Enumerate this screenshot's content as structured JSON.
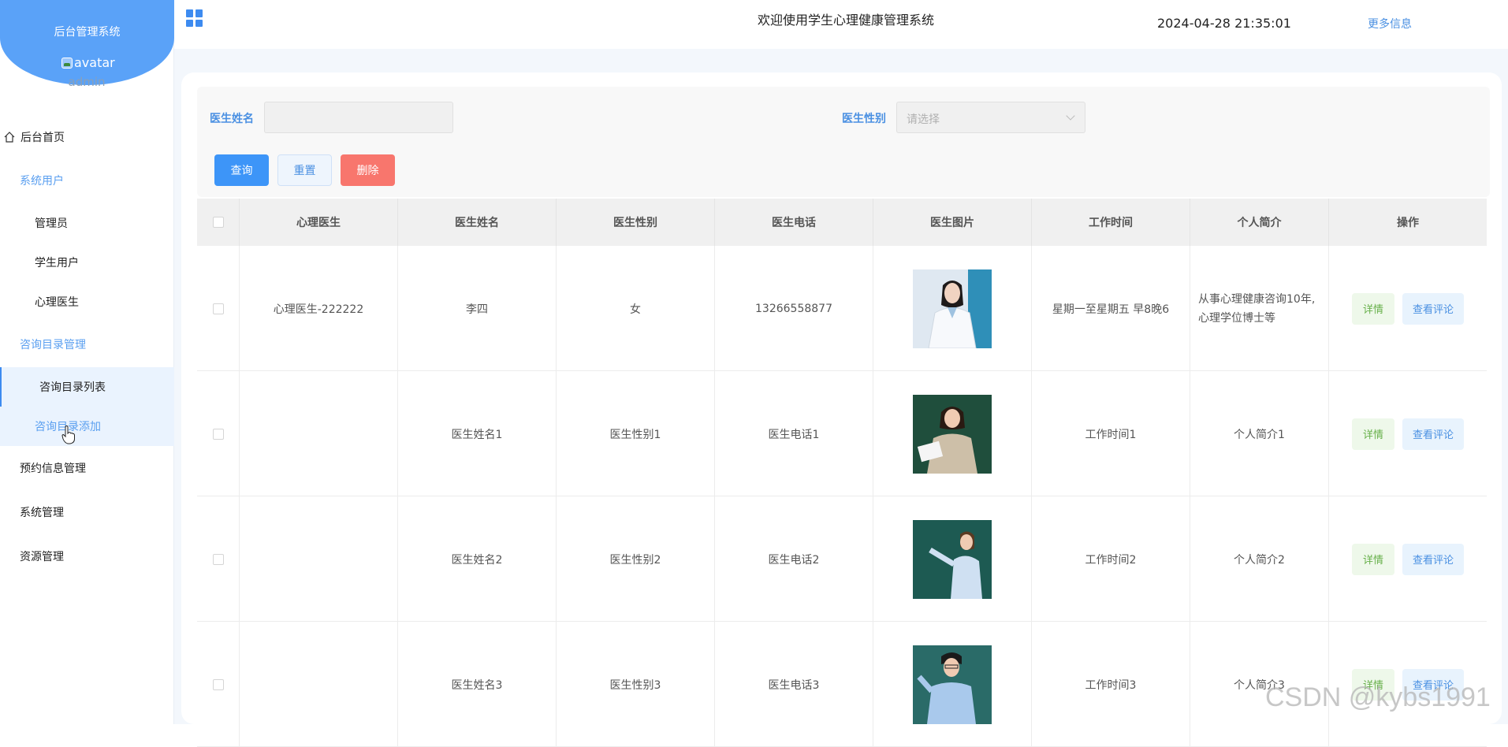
{
  "brand": {
    "title": "后台管理系统",
    "avatar_alt": "avatar",
    "user": "admin"
  },
  "sidebar": {
    "items": [
      {
        "label": "后台首页"
      },
      {
        "label": "系统用户"
      },
      {
        "label": "管理员"
      },
      {
        "label": "学生用户"
      },
      {
        "label": "心理医生"
      },
      {
        "label": "咨询目录管理"
      },
      {
        "label": "咨询目录列表"
      },
      {
        "label": "咨询目录添加"
      },
      {
        "label": "预约信息管理"
      },
      {
        "label": "系统管理"
      },
      {
        "label": "资源管理"
      }
    ]
  },
  "header": {
    "welcome": "欢迎使用学生心理健康管理系统",
    "datetime": "2024-04-28 21:35:01",
    "more_info": "更多信息"
  },
  "filters": {
    "doctor_name_label": "医生姓名",
    "doctor_name_value": "",
    "gender_label": "医生性别",
    "gender_placeholder": "请选择"
  },
  "buttons": {
    "query": "查询",
    "reset": "重置",
    "delete": "删除"
  },
  "table": {
    "headers": [
      "心理医生",
      "医生姓名",
      "医生性别",
      "医生电话",
      "医生图片",
      "工作时间",
      "个人简介",
      "操作"
    ],
    "rows": [
      {
        "doctor": "心理医生-222222",
        "name": "李四",
        "gender": "女",
        "phone": "13266558877",
        "work_time": "星期一至星期五 早8晚6",
        "intro": "从事心理健康咨询10年,心理学位博士等"
      },
      {
        "doctor": "",
        "name": "医生姓名1",
        "gender": "医生性别1",
        "phone": "医生电话1",
        "work_time": "工作时间1",
        "intro": "个人简介1"
      },
      {
        "doctor": "",
        "name": "医生姓名2",
        "gender": "医生性别2",
        "phone": "医生电话2",
        "work_time": "工作时间2",
        "intro": "个人简介2"
      },
      {
        "doctor": "",
        "name": "医生姓名3",
        "gender": "医生性别3",
        "phone": "医生电话3",
        "work_time": "工作时间3",
        "intro": "个人简介3"
      }
    ],
    "detail_label": "详情",
    "review_label": "查看评论"
  },
  "watermark": "CSDN @kybs1991",
  "colors": {
    "accent": "#3d95f8",
    "danger": "#f8766d",
    "success": "#67b04a",
    "brand_blob": "#5aa2f8"
  }
}
